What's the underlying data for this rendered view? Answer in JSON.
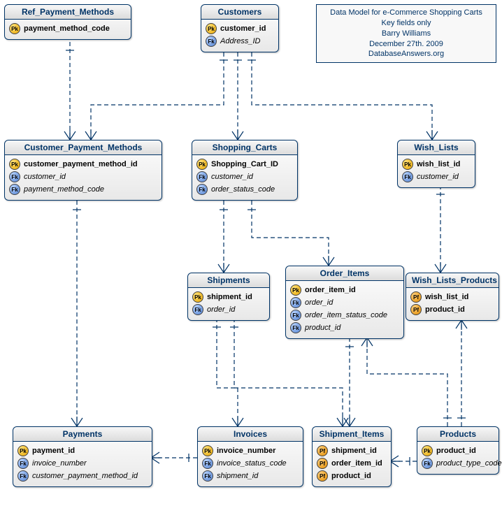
{
  "info": {
    "line1": "Data Model for e-Commerce Shopping Carts",
    "line2": "Key fields only",
    "line3": "Barry Williams",
    "line4": "December 27th. 2009",
    "line5": "DatabaseAnswers.org"
  },
  "entities": {
    "ref_payment_methods": {
      "title": "Ref_Payment_Methods",
      "fields": [
        {
          "key": "PK",
          "name": "payment_method_code",
          "bold": true
        }
      ]
    },
    "customers": {
      "title": "Customers",
      "fields": [
        {
          "key": "PK",
          "name": "customer_id",
          "bold": true
        },
        {
          "key": "FK",
          "name": "Address_ID",
          "italic": true
        }
      ]
    },
    "customer_payment_methods": {
      "title": "Customer_Payment_Methods",
      "fields": [
        {
          "key": "PK",
          "name": "customer_payment_method_id",
          "bold": true
        },
        {
          "key": "FK",
          "name": "customer_id",
          "italic": true
        },
        {
          "key": "FK",
          "name": "payment_method_code",
          "italic": true
        }
      ]
    },
    "shopping_carts": {
      "title": "Shopping_Carts",
      "fields": [
        {
          "key": "PK",
          "name": "Shopping_Cart_ID",
          "bold": true
        },
        {
          "key": "FK",
          "name": "customer_id",
          "italic": true
        },
        {
          "key": "FK",
          "name": "order_status_code",
          "italic": true
        }
      ]
    },
    "wish_lists": {
      "title": "Wish_Lists",
      "fields": [
        {
          "key": "PK",
          "name": "wish_list_id",
          "bold": true
        },
        {
          "key": "FK",
          "name": "customer_id",
          "italic": true
        }
      ]
    },
    "shipments": {
      "title": "Shipments",
      "fields": [
        {
          "key": "PK",
          "name": "shipment_id",
          "bold": true
        },
        {
          "key": "FK",
          "name": "order_id",
          "italic": true
        }
      ]
    },
    "order_items": {
      "title": "Order_Items",
      "fields": [
        {
          "key": "PK",
          "name": "order_item_id",
          "bold": true
        },
        {
          "key": "FK",
          "name": "order_id",
          "italic": true
        },
        {
          "key": "FK",
          "name": "order_item_status_code",
          "italic": true
        },
        {
          "key": "FK",
          "name": "product_id",
          "italic": true
        }
      ]
    },
    "wish_lists_products": {
      "title": "Wish_Lists_Products",
      "fields": [
        {
          "key": "PF",
          "name": "wish_list_id",
          "bold": true
        },
        {
          "key": "PF",
          "name": "product_id",
          "bold": true
        }
      ]
    },
    "payments": {
      "title": "Payments",
      "fields": [
        {
          "key": "PK",
          "name": "payment_id",
          "bold": true
        },
        {
          "key": "FK",
          "name": "invoice_number",
          "italic": true
        },
        {
          "key": "FK",
          "name": "customer_payment_method_id",
          "italic": true
        }
      ]
    },
    "invoices": {
      "title": "Invoices",
      "fields": [
        {
          "key": "PK",
          "name": "invoice_number",
          "bold": true
        },
        {
          "key": "FK",
          "name": "invoice_status_code",
          "italic": true
        },
        {
          "key": "FK",
          "name": "shipment_id",
          "italic": true
        }
      ]
    },
    "shipment_items": {
      "title": "Shipment_Items",
      "fields": [
        {
          "key": "PF",
          "name": "shipment_id",
          "bold": true
        },
        {
          "key": "PF",
          "name": "order_item_id",
          "bold": true
        },
        {
          "key": "PF",
          "name": "product_id",
          "bold": true
        }
      ]
    },
    "products": {
      "title": "Products",
      "fields": [
        {
          "key": "PK",
          "name": "product_id",
          "bold": true
        },
        {
          "key": "FK",
          "name": "product_type_code",
          "italic": true
        }
      ]
    }
  },
  "key_labels": {
    "PK": "Pk",
    "FK": "Fk",
    "PF": "Pf"
  }
}
